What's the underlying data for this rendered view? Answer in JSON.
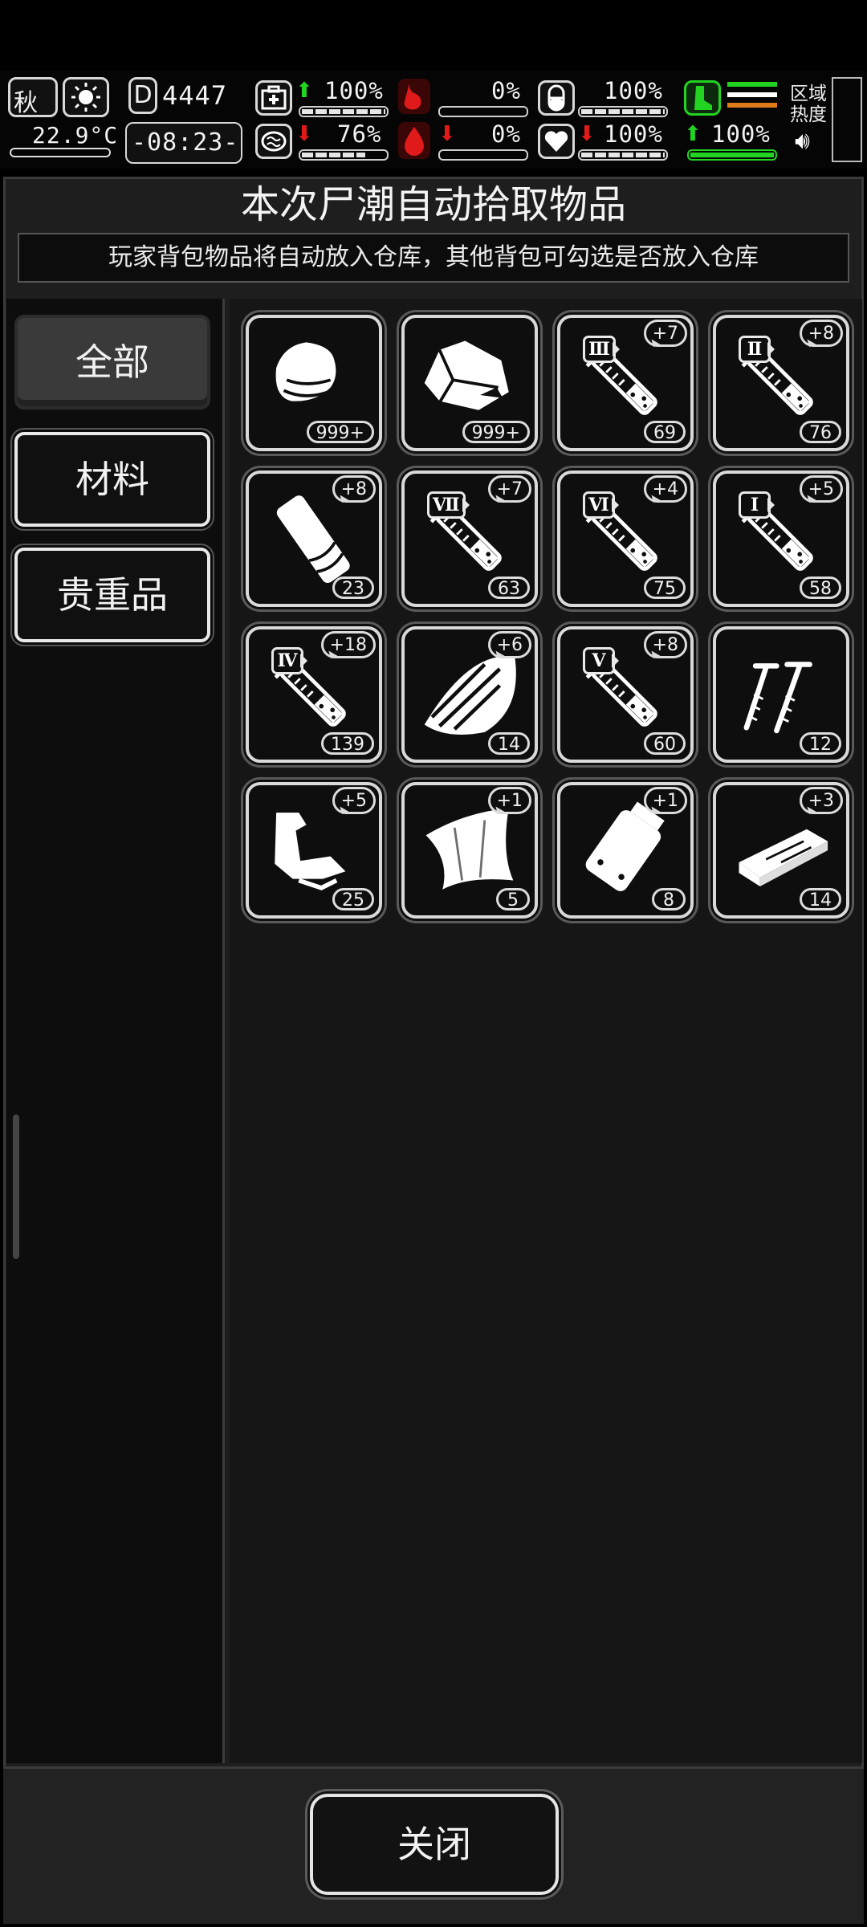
{
  "hud": {
    "season": "秋",
    "temperature": "22.9°C",
    "day_counter": "4447",
    "day_icon_letter": "D",
    "clock": "-08:23-",
    "health_pct": "100%",
    "sanity_pct": "76%",
    "hunger_pct": "0%",
    "bleeding_pct": "0%",
    "pill_pct": "100%",
    "heart_pct": "100%",
    "stamina_pct": "100%",
    "zone_label": "区域热度"
  },
  "panel": {
    "title": "本次尸潮自动拾取物品",
    "subtitle": "玩家背包物品将自动放入仓库，其他背包可勾选是否放入仓库"
  },
  "tabs": [
    {
      "label": "全部"
    },
    {
      "label": "材料"
    },
    {
      "label": "贵重品"
    }
  ],
  "items": [
    {
      "icon": "cloth-icon",
      "count": "999+",
      "bonus": "",
      "roman": ""
    },
    {
      "icon": "stone-icon",
      "count": "999+",
      "bonus": "",
      "roman": ""
    },
    {
      "icon": "syringe-icon",
      "count": "69",
      "bonus": "+7",
      "roman": "Ⅲ"
    },
    {
      "icon": "syringe-icon",
      "count": "76",
      "bonus": "+8",
      "roman": "Ⅱ"
    },
    {
      "icon": "bandage-icon",
      "count": "23",
      "bonus": "+8",
      "roman": ""
    },
    {
      "icon": "syringe-icon",
      "count": "63",
      "bonus": "+7",
      "roman": "Ⅶ"
    },
    {
      "icon": "syringe-icon",
      "count": "75",
      "bonus": "+4",
      "roman": "Ⅵ"
    },
    {
      "icon": "syringe-icon",
      "count": "58",
      "bonus": "+5",
      "roman": "Ⅰ"
    },
    {
      "icon": "syringe-icon",
      "count": "139",
      "bonus": "+18",
      "roman": "Ⅳ"
    },
    {
      "icon": "wood-icon",
      "count": "14",
      "bonus": "+6",
      "roman": ""
    },
    {
      "icon": "syringe-icon",
      "count": "60",
      "bonus": "+8",
      "roman": "Ⅴ"
    },
    {
      "icon": "nails-icon",
      "count": "12",
      "bonus": "",
      "roman": ""
    },
    {
      "icon": "scrap-icon",
      "count": "25",
      "bonus": "+5",
      "roman": ""
    },
    {
      "icon": "fabric-sheet-icon",
      "count": "5",
      "bonus": "+1",
      "roman": ""
    },
    {
      "icon": "bag-icon",
      "count": "8",
      "bonus": "+1",
      "roman": ""
    },
    {
      "icon": "plank-icon",
      "count": "14",
      "bonus": "+3",
      "roman": ""
    }
  ],
  "footer": {
    "close_label": "关闭"
  },
  "colors": {
    "accent_green": "#22d322",
    "alert_red": "#e01a1a",
    "panel_bg": "#1e1e1e"
  }
}
